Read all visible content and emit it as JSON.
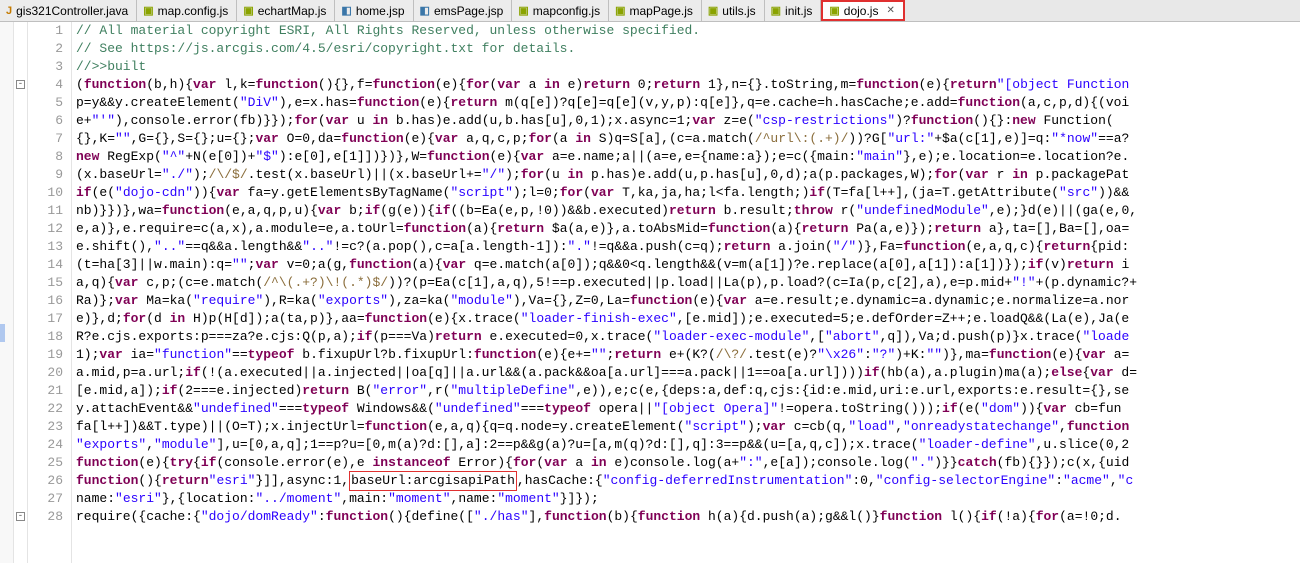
{
  "tabs": [
    {
      "name": "gis321Controller.java",
      "kind": "j"
    },
    {
      "name": "map.config.js",
      "kind": "js"
    },
    {
      "name": "echartMap.js",
      "kind": "js"
    },
    {
      "name": "home.jsp",
      "kind": "jsp"
    },
    {
      "name": "emsPage.jsp",
      "kind": "jsp"
    },
    {
      "name": "mapconfig.js",
      "kind": "js"
    },
    {
      "name": "mapPage.js",
      "kind": "js"
    },
    {
      "name": "utils.js",
      "kind": "js"
    },
    {
      "name": "init.js",
      "kind": "js"
    },
    {
      "name": "dojo.js",
      "kind": "js",
      "active": true,
      "closable": true
    }
  ],
  "lines": [
    {
      "n": 1,
      "html": "<span class='c-cmt'>// All material copyright ESRI, All Rights Reserved, unless otherwise specified.</span>"
    },
    {
      "n": 2,
      "html": "<span class='c-cmt'>// See https://js.arcgis.com/4.5/esri/copyright.txt for details.</span>"
    },
    {
      "n": 3,
      "html": "<span class='c-cmt'>//&gt;&gt;built</span>"
    },
    {
      "n": 4,
      "html": "(<span class='c-kw'>function</span>(b,h){<span class='c-kw'>var</span> l,k=<span class='c-kw'>function</span>(){},f=<span class='c-kw'>function</span>(e){<span class='c-kw'>for</span>(<span class='c-kw'>var</span> a <span class='c-kw'>in</span> e)<span class='c-kw'>return</span> 0;<span class='c-kw'>return</span> 1},n={}.toString,m=<span class='c-kw'>function</span>(e){<span class='c-kw'>return</span><span class='c-str'>\"[object Function</span>"
    },
    {
      "n": 5,
      "html": "p=y&amp;&amp;y.createElement(<span class='c-str'>\"DiV\"</span>),e=x.has=<span class='c-kw'>function</span>(e){<span class='c-kw'>return</span> m(q[e])?q[e]=q[e](v,y,p):q[e]},q=e.cache=h.hasCache;e.add=<span class='c-kw'>function</span>(a,c,p,d){(voi"
    },
    {
      "n": 6,
      "html": "e+<span class='c-str'>\"'\"</span>),console.error(fb)}});<span class='c-kw'>for</span>(<span class='c-kw'>var</span> u <span class='c-kw'>in</span> b.has)e.add(u,b.has[u],0,1);x.async=1;<span class='c-kw'>var</span> z=e(<span class='c-str'>\"csp-restrictions\"</span>)?<span class='c-kw'>function</span>(){}:<span class='c-kw'>new</span> Function("
    },
    {
      "n": 7,
      "html": "{},K=<span class='c-str'>\"\"</span>,G={},S={};u={};<span class='c-kw'>var</span> O=0,da=<span class='c-kw'>function</span>(e){<span class='c-kw'>var</span> a,q,c,p;<span class='c-kw'>for</span>(a <span class='c-kw'>in</span> S)q=S[a],(c=a.match(<span class='c-re'>/^url\\:(.+)/</span>))?G[<span class='c-str'>\"url:\"</span>+$a(c[1],e)]=q:<span class='c-str'>\"*now\"</span>==a?"
    },
    {
      "n": 8,
      "html": "<span class='c-kw'>new</span> RegExp(<span class='c-str'>\"^\"</span>+N(e[0])+<span class='c-str'>\"$\"</span>):e[0],e[1]])})},W=<span class='c-kw'>function</span>(e){<span class='c-kw'>var</span> a=e.name;a||(a=e,e={name:a});e=c({main:<span class='c-str'>\"main\"</span>},e);e.location=e.location?e."
    },
    {
      "n": 9,
      "html": "(x.baseUrl=<span class='c-str'>\"./\"</span>);<span class='c-re'>/\\/$/</span>.test(x.baseUrl)||(x.baseUrl+=<span class='c-str'>\"/\"</span>);<span class='c-kw'>for</span>(u <span class='c-kw'>in</span> p.has)e.add(u,p.has[u],0,d);a(p.packages,W);<span class='c-kw'>for</span>(<span class='c-kw'>var</span> r <span class='c-kw'>in</span> p.packagePat"
    },
    {
      "n": 10,
      "html": "<span class='c-kw'>if</span>(e(<span class='c-str'>\"dojo-cdn\"</span>)){<span class='c-kw'>var</span> fa=y.getElementsByTagName(<span class='c-str'>\"script\"</span>);l=0;<span class='c-kw'>for</span>(<span class='c-kw'>var</span> T,ka,ja,ha;l&lt;fa.length;)<span class='c-kw'>if</span>(T=fa[l++],(ja=T.getAttribute(<span class='c-str'>\"src\"</span>))&amp;&amp;"
    },
    {
      "n": 11,
      "html": "nb)}})},wa=<span class='c-kw'>function</span>(e,a,q,p,u){<span class='c-kw'>var</span> b;<span class='c-kw'>if</span>(g(e)){<span class='c-kw'>if</span>((b=Ea(e,p,!0))&amp;&amp;b.executed)<span class='c-kw'>return</span> b.result;<span class='c-kw'>throw</span> r(<span class='c-str'>\"undefinedModule\"</span>,e);}d(e)||(ga(e,0,"
    },
    {
      "n": 12,
      "html": "e,a)},e.require=c(a,x),a.module=e,a.toUrl=<span class='c-kw'>function</span>(a){<span class='c-kw'>return</span> $a(a,e)},a.toAbsMid=<span class='c-kw'>function</span>(a){<span class='c-kw'>return</span> Pa(a,e)});<span class='c-kw'>return</span> a},ta=[],Ba=[],oa="
    },
    {
      "n": 13,
      "html": "e.shift(),<span class='c-str'>\"..\"</span>==q&amp;&amp;a.length&amp;&amp;<span class='c-str'>\"..\"</span>!=c?(a.pop(),c=a[a.length-1]):<span class='c-str'>\".\"</span>!=q&amp;&amp;a.push(c=q);<span class='c-kw'>return</span> a.join(<span class='c-str'>\"/\"</span>)},Fa=<span class='c-kw'>function</span>(e,a,q,c){<span class='c-kw'>return</span>{pid:"
    },
    {
      "n": 14,
      "html": "(t=ha[3]||w.main):q=<span class='c-str'>\"\"</span>;<span class='c-kw'>var</span> v=0;a(g,<span class='c-kw'>function</span>(a){<span class='c-kw'>var</span> q=e.match(a[0]);q&amp;&amp;0&lt;q.length&amp;&amp;(v=m(a[1])?e.replace(a[0],a[1]):a[1])});<span class='c-kw'>if</span>(v)<span class='c-kw'>return</span> i"
    },
    {
      "n": 15,
      "html": "a,q){<span class='c-kw'>var</span> c,p;(c=e.match(<span class='c-re'>/^\\(.+?)\\!(.*)$/</span>))?(p=Ea(c[1],a,q),5!==p.executed||p.load||La(p),p.load?(c=Ia(p,c[2],a),e=p.mid+<span class='c-str'>\"!\"</span>+(p.dynamic?+"
    },
    {
      "n": 16,
      "html": "Ra)};<span class='c-kw'>var</span> Ma=ka(<span class='c-str'>\"require\"</span>),R=ka(<span class='c-str'>\"exports\"</span>),za=ka(<span class='c-str'>\"module\"</span>),Va={},Z=0,La=<span class='c-kw'>function</span>(e){<span class='c-kw'>var</span> a=e.result;e.dynamic=a.dynamic;e.normalize=a.nor"
    },
    {
      "n": 17,
      "html": "e)},d;<span class='c-kw'>for</span>(d <span class='c-kw'>in</span> H)p(H[d]);a(ta,p)},aa=<span class='c-kw'>function</span>(e){x.trace(<span class='c-str'>\"loader-finish-exec\"</span>,[e.mid]);e.executed=5;e.defOrder=Z++;e.loadQ&amp;&amp;(La(e),Ja(e"
    },
    {
      "n": 18,
      "html": "R?e.cjs.exports:p===za?e.cjs:Q(p,a);<span class='c-kw'>if</span>(p===Va)<span class='c-kw'>return</span> e.executed=0,x.trace(<span class='c-str'>\"loader-exec-module\"</span>,[<span class='c-str'>\"abort\"</span>,q]),Va;d.push(p)}x.trace(<span class='c-str'>\"loade</span>"
    },
    {
      "n": 19,
      "html": "1);<span class='c-kw'>var</span> ia=<span class='c-str'>\"function\"</span>==<span class='c-kw'>typeof</span> b.fixupUrl?b.fixupUrl:<span class='c-kw'>function</span>(e){e+=<span class='c-str'>\"\"</span>;<span class='c-kw'>return</span> e+(K?(<span class='c-re'>/\\?/</span>.test(e)?<span class='c-str'>\"\\x26\"</span>:<span class='c-str'>\"?\"</span>)+K:<span class='c-str'>\"\"</span>)},ma=<span class='c-kw'>function</span>(e){<span class='c-kw'>var</span> a="
    },
    {
      "n": 20,
      "html": "a.mid,p=a.url;<span class='c-kw'>if</span>(!(a.executed||a.injected||oa[q]||a.url&amp;&amp;(a.pack&amp;&amp;oa[a.url]===a.pack||1==oa[a.url])))<span class='c-kw'>if</span>(hb(a),a.plugin)ma(a);<span class='c-kw'>else</span>{<span class='c-kw'>var</span> d="
    },
    {
      "n": 21,
      "html": "[e.mid,a]);<span class='c-kw'>if</span>(2===e.injected)<span class='c-kw'>return</span> B(<span class='c-str'>\"error\"</span>,r(<span class='c-str'>\"multipleDefine\"</span>,e)),e;c(e,{deps:a,def:q,cjs:{id:e.mid,uri:e.url,exports:e.result={},se"
    },
    {
      "n": 22,
      "html": "y.attachEvent&amp;&amp;<span class='c-str'>\"undefined\"</span>===<span class='c-kw'>typeof</span> Windows&amp;&amp;(<span class='c-str'>\"undefined\"</span>===<span class='c-kw'>typeof</span> opera||<span class='c-str'>\"[object Opera]\"</span>!=opera.toString()));<span class='c-kw'>if</span>(e(<span class='c-str'>\"dom\"</span>)){<span class='c-kw'>var</span> cb=fun"
    },
    {
      "n": 23,
      "html": "fa[l++])&amp;&amp;T.type)||(O=T);x.injectUrl=<span class='c-kw'>function</span>(e,a,q){q=q.node=y.createElement(<span class='c-str'>\"script\"</span>);<span class='c-kw'>var</span> c=cb(q,<span class='c-str'>\"load\"</span>,<span class='c-str'>\"onreadystatechange\"</span>,<span class='c-kw'>function</span>"
    },
    {
      "n": 24,
      "html": "<span class='c-str'>\"exports\"</span>,<span class='c-str'>\"module\"</span>],u=[0,a,q];1==p?u=[0,m(a)?d:[],a]:2==p&amp;&amp;g(a)?u=[a,m(q)?d:[],q]:3==p&amp;&amp;(u=[a,q,c]);x.trace(<span class='c-str'>\"loader-define\"</span>,u.slice(0,2"
    },
    {
      "n": 25,
      "html": "<span class='c-kw'>function</span>(e){<span class='c-kw'>try</span>{<span class='c-kw'>if</span>(console.error(e),e <span class='c-kw'>instanceof</span> Error){<span class='c-kw'>for</span>(<span class='c-kw'>var</span> a <span class='c-kw'>in</span> e)console.log(a+<span class='c-str'>\":\"</span>,e[a]);console.log(<span class='c-str'>\".\"</span>)}}<span class='c-kw'>catch</span>(fb){}});c(x,{uid"
    },
    {
      "n": 26,
      "html": "<span class='c-kw'>function</span>(){<span class='c-kw'>return</span><span class='c-str'>\"esri\"</span>}]],async:1,<span class='hl-box'>baseUrl:arcgisapiPath</span>,hasCache:{<span class='c-str'>\"config-deferredInstrumentation\"</span>:0,<span class='c-str'>\"config-selectorEngine\"</span>:<span class='c-str'>\"acme\"</span>,<span class='c-str'>\"c</span>"
    },
    {
      "n": 27,
      "html": "name:<span class='c-str'>\"esri\"</span>},{location:<span class='c-str'>\"../moment\"</span>,main:<span class='c-str'>\"moment\"</span>,name:<span class='c-str'>\"moment\"</span>}]});"
    },
    {
      "n": 28,
      "html": "require({cache:{<span class='c-str'>\"dojo/domReady\"</span>:<span class='c-kw'>function</span>(){define([<span class='c-str'>\"./has\"</span>],<span class='c-kw'>function</span>(b){<span class='c-kw'>function</span> h(a){d.push(a);g&amp;&amp;l()}<span class='c-kw'>function</span> l(){<span class='c-kw'>if</span>(!a){<span class='c-kw'>for</span>(a=!0;d."
    }
  ]
}
